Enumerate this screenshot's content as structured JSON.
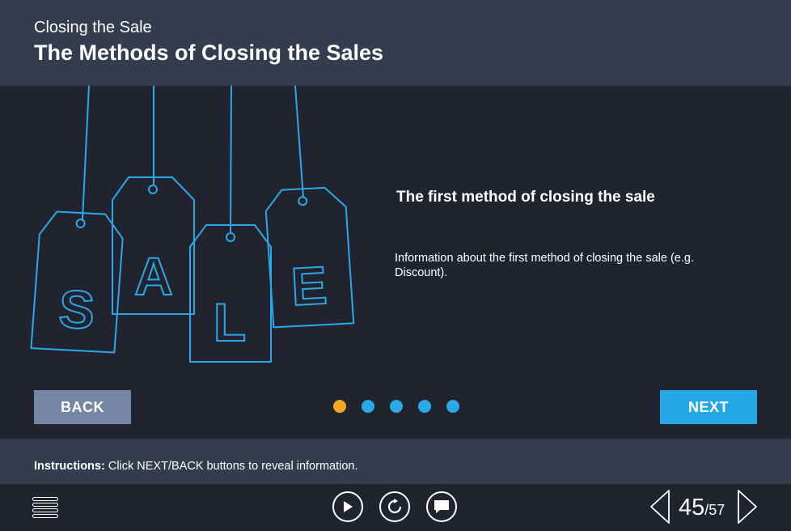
{
  "header": {
    "subtitle": "Closing the Sale",
    "title": "The Methods of Closing the Sales"
  },
  "illustration": {
    "letters": [
      "S",
      "A",
      "L",
      "E"
    ],
    "stroke_color": "#2aa8e8"
  },
  "info": {
    "title": "The first method of closing the sale",
    "body": "Information about the first method of closing the sale (e.g. Discount)."
  },
  "navigation": {
    "back_label": "BACK",
    "next_label": "NEXT",
    "step_count": 5,
    "active_step": 1
  },
  "instructions": {
    "label": "Instructions:",
    "text": " Click NEXT/BACK buttons to reveal information."
  },
  "footer": {
    "menu_icon": "hamburger-menu-icon",
    "play_icon": "play-icon",
    "replay_icon": "replay-icon",
    "chat_icon": "chat-icon",
    "page_current": "45",
    "page_total": "/57"
  },
  "colors": {
    "header_bg": "#333d4e",
    "content_bg": "#21242f",
    "accent_blue": "#25a7e6",
    "back_button": "#7585a4",
    "active_dot": "#f5a623"
  }
}
